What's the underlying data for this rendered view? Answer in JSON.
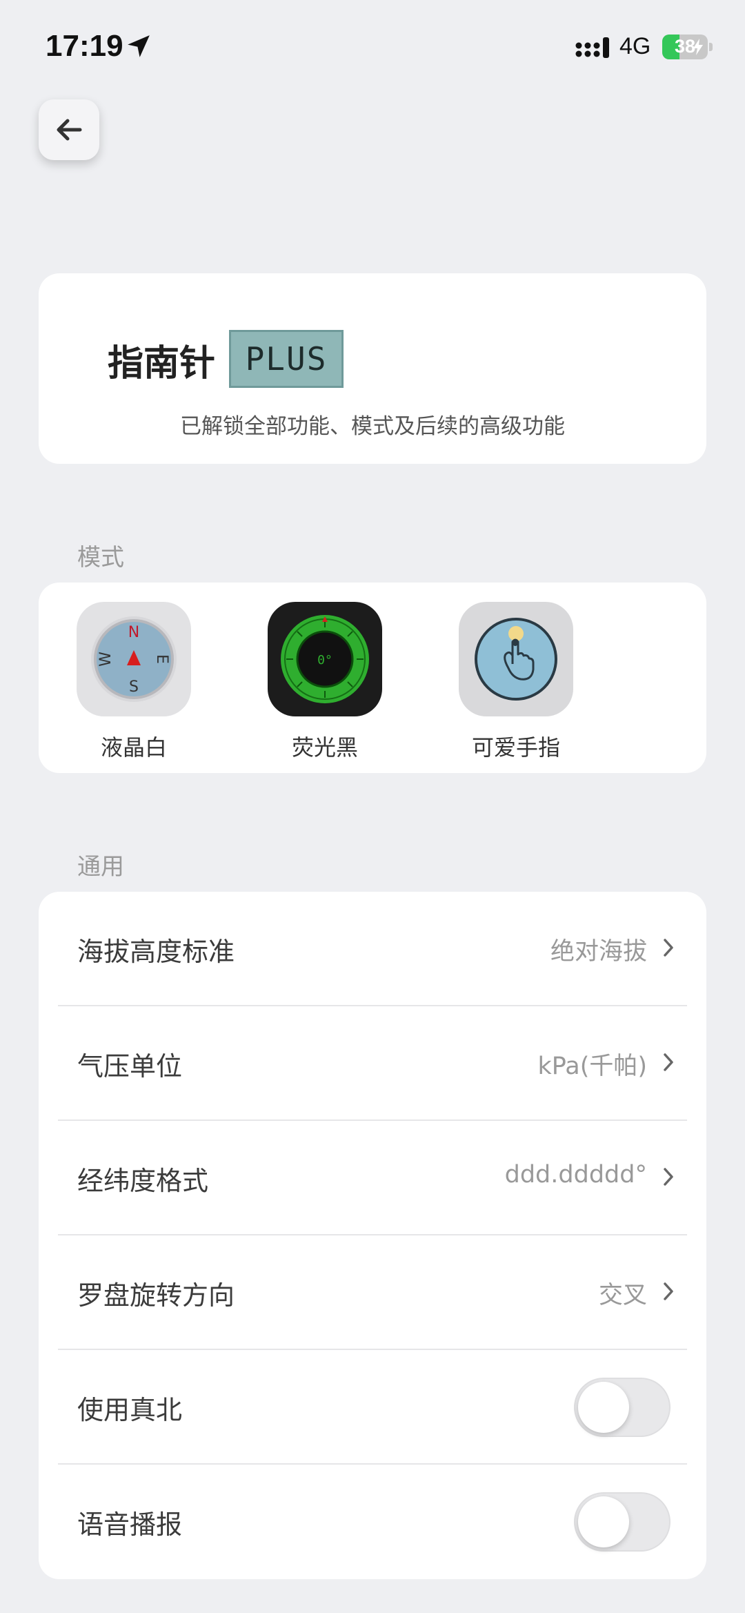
{
  "status_bar": {
    "time": "17:19",
    "network": "4G",
    "battery": "38",
    "battery_level": 0.38
  },
  "hero": {
    "title": "指南针",
    "badge": "PLUS",
    "subtitle": "已解锁全部功能、模式及后续的高级功能"
  },
  "modes": {
    "title": "模式",
    "items": [
      {
        "label": "液晶白",
        "icon": "compass-white-icon"
      },
      {
        "label": "荧光黑",
        "icon": "compass-green-icon",
        "readout": "0°"
      },
      {
        "label": "可爱手指",
        "icon": "finger-compass-icon"
      }
    ],
    "compass_letters": {
      "n": "N",
      "e": "E",
      "s": "S",
      "w": "W"
    }
  },
  "general": {
    "title": "通用",
    "rows": [
      {
        "label": "海拔高度标准",
        "value": "绝对海拔"
      },
      {
        "label": "气压单位",
        "value": "kPa(千帕)"
      },
      {
        "label": "经纬度格式",
        "value": "ddd.ddddd°"
      },
      {
        "label": "罗盘旋转方向",
        "value": "交叉"
      },
      {
        "label": "使用真北",
        "toggle": false
      },
      {
        "label": "语音播报",
        "toggle": false
      }
    ]
  },
  "colors": {
    "background": "#eeeff2",
    "card": "#ffffff",
    "plus_badge": "#8fb7b7",
    "battery_green": "#34c759",
    "accent_red": "#d81e1e"
  }
}
